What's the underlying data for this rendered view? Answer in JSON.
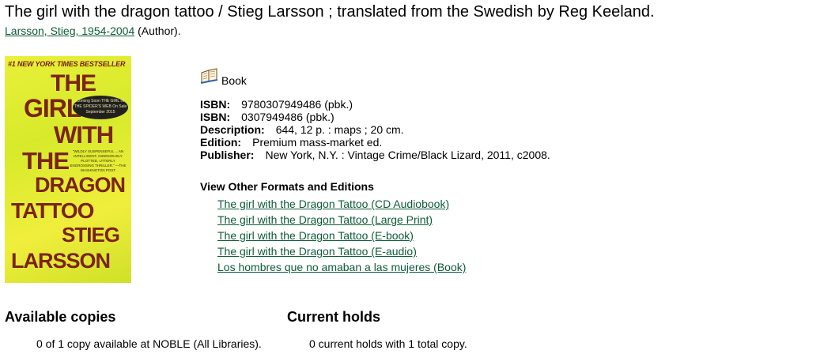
{
  "record": {
    "title": "The girl with the dragon tattoo / Stieg Larsson ; translated from the Swedish by Reg Keeland.",
    "author_link": "Larsson, Stieg, 1954-2004",
    "author_role": " (Author)."
  },
  "cover": {
    "top_text": "#1 NEW YORK TIMES BESTSELLER",
    "lines": [
      "THE",
      "GIRL",
      "WITH",
      "THE",
      "DRAGON",
      "TATTOO",
      "STIEG",
      "LARSSON"
    ],
    "badge_text": "Coming Soon THE GIRL IN THE SPIDER'S WEB On Sale September 2015",
    "quote_text": "\"WILDLY SUSPENSEFUL ... AN INTELLIGENT, INGENIOUSLY PLOTTED, UTTERLY ENGROSSING THRILLER.\" —THE WASHINGTON POST"
  },
  "format": {
    "label": "Book",
    "icon": "book-icon"
  },
  "details": {
    "isbn_label": "ISBN:",
    "isbn1": "9780307949486 (pbk.)",
    "isbn2": "0307949486 (pbk.)",
    "description_label": "Description:",
    "description": "644, 12 p. : maps ; 20 cm.",
    "edition_label": "Edition:",
    "edition": "Premium mass-market ed.",
    "publisher_label": "Publisher:",
    "publisher": "New York, N.Y. : Vintage Crime/Black Lizard, 2011, c2008."
  },
  "other_formats": {
    "heading": "View Other Formats and Editions",
    "items": [
      "The girl with the Dragon Tattoo (CD Audiobook)",
      "The girl with the Dragon Tattoo (Large Print)",
      "The girl with the Dragon Tattoo (E-book)",
      "The girl with the Dragon Tattoo (E-audio)",
      "Los hombres que no amaban a las mujeres (Book)"
    ]
  },
  "copies": {
    "heading": "Available copies",
    "text": "0 of 1 copy available at NOBLE (All Libraries)."
  },
  "holds": {
    "heading": "Current holds",
    "text": "0 current holds with 1 total copy."
  },
  "colors": {
    "link": "#0d5c36",
    "cover_bg": "#e0ec30",
    "cover_text": "#7b2416"
  }
}
